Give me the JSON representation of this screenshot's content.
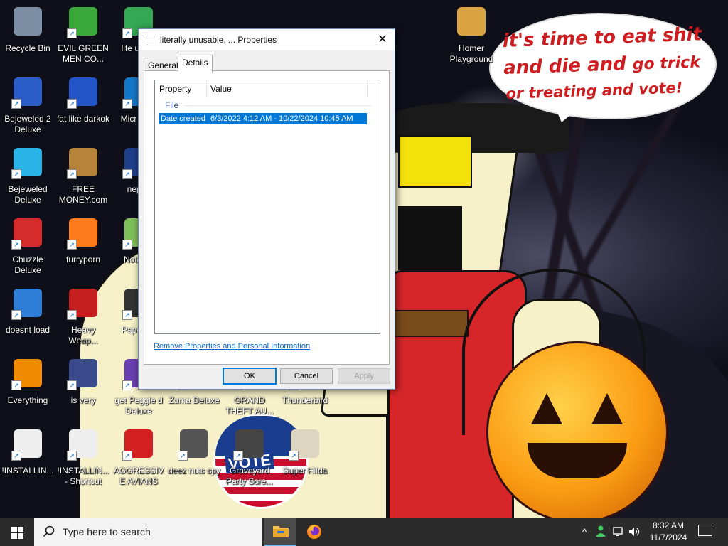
{
  "wallpaper": {
    "bubble_line1": "it's time to eat shit",
    "bubble_line2_big": "and die and ",
    "bubble_line2_small": "go trick",
    "bubble_line3": "or treating and vote!",
    "badge_text": "VOTE"
  },
  "desktop_icons": [
    {
      "label": "Recycle Bin",
      "icon": "recycle-bin-icon",
      "color": "#7b8ea3"
    },
    {
      "label": "EVIL GREEN MEN CO...",
      "icon": "green-men-icon",
      "color": "#3aa83a"
    },
    {
      "label": "Bejeweled 2 Deluxe",
      "icon": "bejeweled-2-icon",
      "color": "#2b5cc7"
    },
    {
      "label": "fat like darkok",
      "icon": "mpl-logo-icon",
      "color": "#2355c8"
    },
    {
      "label": "Bejeweled Deluxe",
      "icon": "diamond-icon",
      "color": "#29b3e6"
    },
    {
      "label": "FREE MONEY.com",
      "icon": "money-bag-icon",
      "color": "#b5833a"
    },
    {
      "label": "Chuzzle Deluxe",
      "icon": "chuzzle-icon",
      "color": "#d62b2b"
    },
    {
      "label": "furryporn",
      "icon": "firefox-icon",
      "color": "#ff7a1a"
    },
    {
      "label": "doesnt load",
      "icon": "thunderbird-icon",
      "color": "#2f7fd8"
    },
    {
      "label": "Heavy Weap...",
      "icon": "radiation-icon",
      "color": "#c41e1e"
    },
    {
      "label": "Everything",
      "icon": "everything-search-icon",
      "color": "#f08a00"
    },
    {
      "label": "is very",
      "icon": "mpl-shield-icon",
      "color": "#3a4a8a"
    },
    {
      "label": "!INSTALLIN...",
      "icon": "document-icon",
      "color": "#eeeeee"
    },
    {
      "label": "!INSTALLIN... - Shortcut",
      "icon": "document-shortcut-icon",
      "color": "#eeeeee"
    },
    {
      "label": "AGGRESSIVE AVIANS",
      "icon": "angry-bird-icon",
      "color": "#d42020"
    },
    {
      "label": "deez nuts spy",
      "icon": "windows-stack-icon",
      "color": "#555555"
    },
    {
      "label": "Graveyard Party Scre...",
      "icon": "graveyard-icon",
      "color": "#444444"
    },
    {
      "label": "Super Hilda",
      "icon": "pixel-cat-icon",
      "color": "#ddd5c0"
    },
    {
      "label": "Homer Playground",
      "icon": "folder-icon",
      "color": "#d9a441"
    },
    {
      "label": "lite unu...",
      "icon": "chrome-icon",
      "color": "#34a853"
    },
    {
      "label": "Micr Ed...",
      "icon": "edge-icon",
      "color": "#1577c8"
    },
    {
      "label": "nepl...",
      "icon": "nepl-icon",
      "color": "#1e3f8a"
    },
    {
      "label": "Notep...",
      "icon": "notepad-icon",
      "color": "#7fbf5a"
    },
    {
      "label": "Papers...",
      "icon": "papers-icon",
      "color": "#333333"
    },
    {
      "label": "get Peggle d Deluxe",
      "icon": "peggle-icon",
      "color": "#6a3fb0"
    },
    {
      "label": "Zuma Deluxe",
      "icon": "zuma-icon",
      "color": "#3b7a2b"
    },
    {
      "label": "GRAND THEFT AU...",
      "icon": "gta-icon",
      "color": "#333333"
    },
    {
      "label": "Thunderbird",
      "icon": "thunderbird-2-icon",
      "color": "#2f7fd8"
    }
  ],
  "dialog": {
    "title": "literally unusable, ... Properties",
    "close_glyph": "✕",
    "tabs": [
      "General",
      "Details"
    ],
    "active_tab": "Details",
    "columns": [
      "Property",
      "Value"
    ],
    "group": "File",
    "rows": [
      {
        "property": "Date created",
        "value": "6/3/2022 4:12 AM - 10/22/2024 10:45 AM",
        "selected": true
      }
    ],
    "remove_link": "Remove Properties and Personal Information",
    "ok_label": "OK",
    "cancel_label": "Cancel",
    "apply_label": "Apply"
  },
  "taskbar": {
    "search_placeholder": "Type here to search",
    "time": "8:32 AM",
    "date": "11/7/2024",
    "tray_chevron": "^"
  },
  "colors": {
    "accent": "#0078d7",
    "taskbar": "#2b2b2b",
    "bubble_text": "#cc1d20"
  }
}
